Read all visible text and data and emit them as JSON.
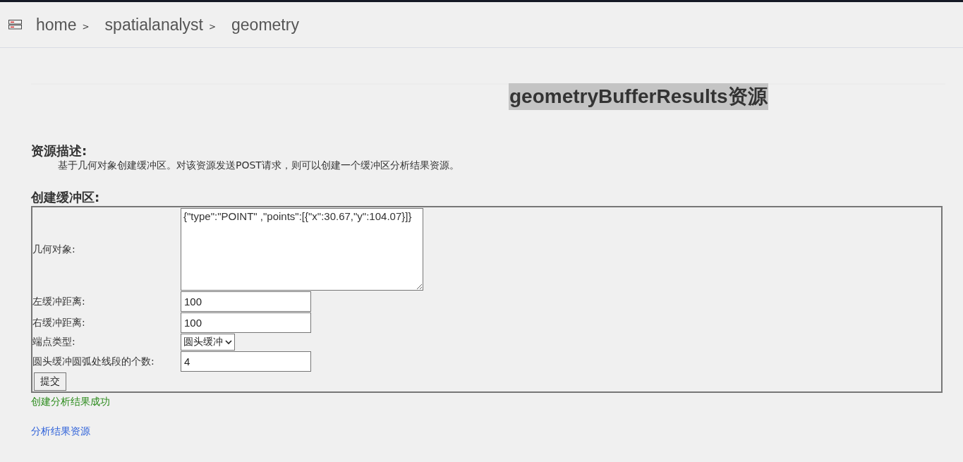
{
  "breadcrumb": [
    {
      "label": "home",
      "separator": ">"
    },
    {
      "label": "spatialanalyst",
      "separator": ">"
    },
    {
      "label": "geometry"
    }
  ],
  "title": "geometryBufferResults资源",
  "description": {
    "heading": "资源描述:",
    "text": "基于几何对象创建缓冲区。对该资源发送POST请求，则可以创建一个缓冲区分析结果资源。"
  },
  "form": {
    "heading": "创建缓冲区:",
    "fields": [
      {
        "kind": "textarea",
        "label": "几何对象:",
        "value": "{\"type\":\"POINT\" ,\"points\":[{\"x\":30.67,\"y\":104.07}]}"
      },
      {
        "kind": "text",
        "label": "左缓冲距离:",
        "value": "100"
      },
      {
        "kind": "text",
        "label": "右缓冲距离:",
        "value": "100"
      },
      {
        "kind": "select",
        "label": "端点类型:",
        "value": "圆头缓冲"
      },
      {
        "kind": "text",
        "label": "圆头缓冲圆弧处线段的个数:",
        "value": "4"
      }
    ],
    "submit": "提交"
  },
  "status": "创建分析结果成功",
  "result_link": "分析结果资源"
}
